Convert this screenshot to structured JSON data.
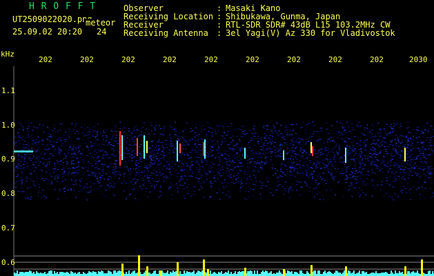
{
  "header": {
    "brand": "H R O F F T",
    "filename": "UT2509022020.png",
    "meteor_label": "meteor",
    "datetime": "25.09.02 20:20",
    "meteor_count": "24"
  },
  "station": {
    "observer_label": "Observer",
    "observer_value": "Masaki Kano",
    "location_label": "Receiving Location",
    "location_value": "Shibukawa, Gunma, Japan",
    "receiver_label": "Receiver",
    "receiver_value": "RTL-SDR SDR# 43dB L15 103.2MHz CW",
    "antenna_label": "Receiving Antenna",
    "antenna_value": "3el Yagi(V) Az 330 for Vladivostok",
    "separator": ":"
  },
  "axis": {
    "unit": "kHz",
    "y_ticks": [
      "1.1",
      "1.0",
      "0.9",
      "0.8",
      "0.7",
      "0.6"
    ],
    "x_ticks": [
      "202",
      "202",
      "202",
      "202",
      "202",
      "202",
      "202",
      "202",
      "202",
      "2030"
    ]
  },
  "colors": {
    "text": "#ffff55",
    "brand": "#22e05a",
    "background": "#000000",
    "noise": "#1a24c8",
    "signal": "#55ffff",
    "meteor": "#ffff00"
  }
}
